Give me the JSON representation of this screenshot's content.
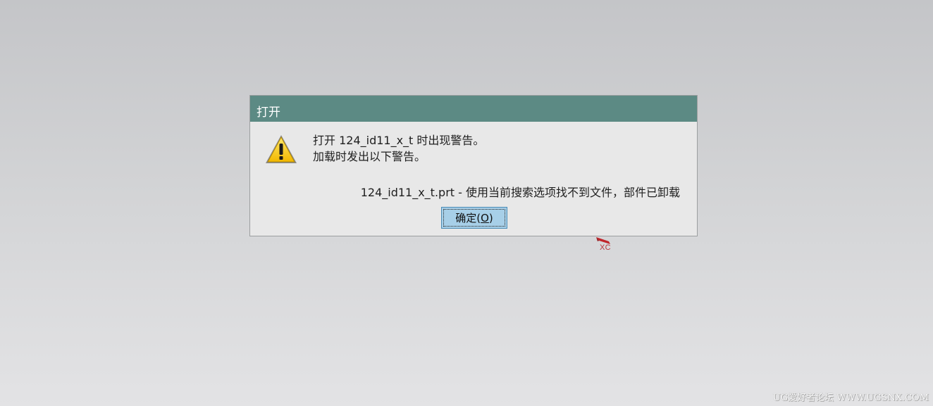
{
  "dialog": {
    "title": "打开",
    "icon": "warning-icon",
    "message_line1": "打开 124_id11_x_t 时出现警告。",
    "message_line2": "加载时发出以下警告。",
    "detail": "124_id11_x_t.prt - 使用当前搜索选项找不到文件，部件已卸载",
    "ok_button": {
      "prefix": "确定(",
      "mnemonic": "O",
      "suffix": ")"
    }
  },
  "axis_triad": {
    "label": "XC",
    "color": "#b8383c"
  },
  "watermark": "UG爱好者论坛 WWW.UGSNX.COM",
  "colors": {
    "titlebar": "#5c8a84",
    "dialog_bg": "#e8e8e8",
    "button_bg": "#a7cfe8",
    "button_border": "#4a8bb5"
  }
}
